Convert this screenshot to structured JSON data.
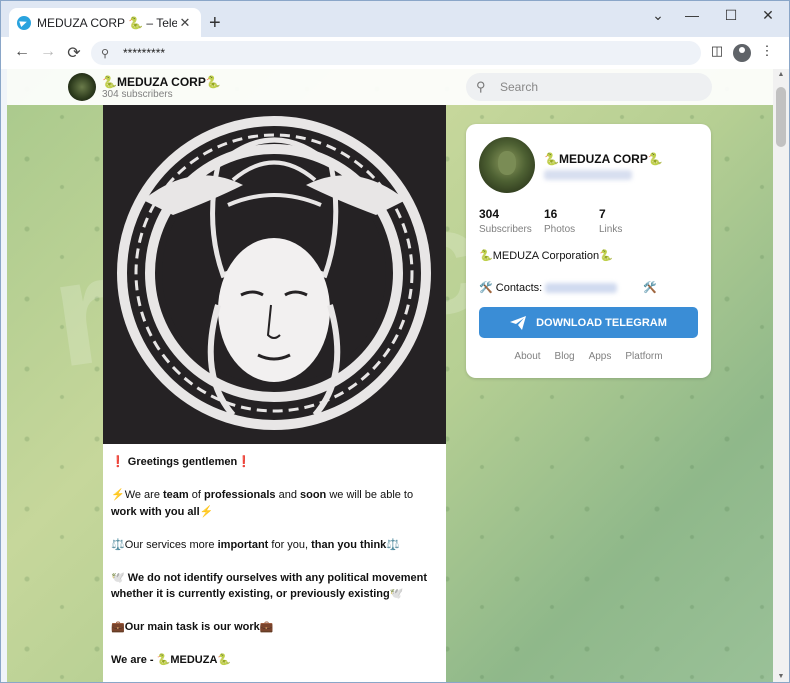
{
  "browser": {
    "tab_title": "MEDUZA CORP 🐍 – Telegram",
    "tab_close": "✕",
    "new_tab": "+",
    "window_controls": [
      "⌄",
      "—",
      "☐",
      "✕"
    ],
    "url": "*********",
    "nav": {
      "back": "←",
      "forward": "→",
      "reload": "⟳"
    }
  },
  "channel": {
    "name": "🐍MEDUZA CORP🐍",
    "subscribers_line": "304 subscribers"
  },
  "search": {
    "placeholder": "Search"
  },
  "post": {
    "paragraphs": [
      {
        "segments": [
          {
            "t": "❗ ",
            "b": false
          },
          {
            "t": "Greetings gentlemen",
            "b": true
          },
          {
            "t": "❗",
            "b": false
          }
        ]
      },
      {
        "segments": [
          {
            "t": "⚡We are ",
            "b": false
          },
          {
            "t": "team",
            "b": true
          },
          {
            "t": " of ",
            "b": false
          },
          {
            "t": "professionals",
            "b": true
          },
          {
            "t": "  and ",
            "b": false
          },
          {
            "t": "soon",
            "b": true
          },
          {
            "t": " we will be able to ",
            "b": false
          },
          {
            "t": "work with you all",
            "b": true
          },
          {
            "t": "⚡",
            "b": false
          }
        ]
      },
      {
        "segments": [
          {
            "t": "⚖️Our services more ",
            "b": false
          },
          {
            "t": "important",
            "b": true
          },
          {
            "t": " for you, ",
            "b": false
          },
          {
            "t": "than you think",
            "b": true
          },
          {
            "t": "⚖️",
            "b": false
          }
        ]
      },
      {
        "segments": [
          {
            "t": "🕊️ ",
            "b": false
          },
          {
            "t": "We do not identify ourselves with any political movement whether it is currently existing, or previously existing",
            "b": true
          },
          {
            "t": "🕊️",
            "b": false
          }
        ]
      },
      {
        "segments": [
          {
            "t": "💼",
            "b": false
          },
          {
            "t": "Our main task is our work",
            "b": true
          },
          {
            "t": "💼",
            "b": false
          }
        ]
      },
      {
        "segments": [
          {
            "t": "We are - ",
            "b": true
          },
          {
            "t": "🐍MEDUZA🐍",
            "b": true
          }
        ]
      }
    ]
  },
  "card": {
    "name": "🐍MEDUZA CORP🐍",
    "stats": [
      {
        "value": "304",
        "label": "Subscribers"
      },
      {
        "value": "16",
        "label": "Photos"
      },
      {
        "value": "7",
        "label": "Links"
      }
    ],
    "description": "🐍MEDUZA Corporation🐍",
    "contacts_label": "🛠️ Contacts:",
    "contacts_suffix": "🛠️",
    "download_label": "DOWNLOAD TELEGRAM",
    "links": [
      "About",
      "Blog",
      "Apps",
      "Platform"
    ]
  },
  "icons": {
    "telegram": "telegram-icon",
    "search": "search-icon",
    "profile": "profile-icon",
    "menu": "kebab-menu-icon"
  },
  "colors": {
    "button": "#3a8dd6",
    "tabbar": "#dfe7f3",
    "post_image_bg": "#252224"
  }
}
